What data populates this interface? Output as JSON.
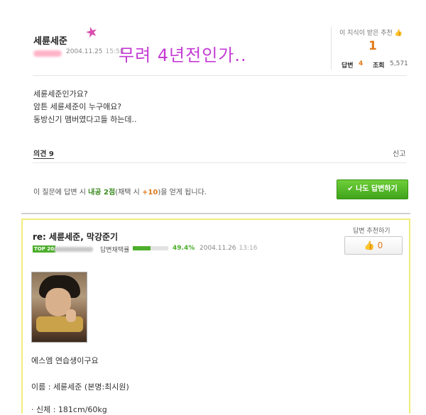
{
  "question": {
    "title": "세륜세준",
    "date": "2004.11.25",
    "time": "15:58",
    "handwritten_note": "무려 4년전인가..",
    "stats": {
      "rec_label": "이 지식이 받은 추천",
      "rec_count": "1",
      "answers_label": "답변",
      "answers_count": "4",
      "views_label": "조회",
      "views_count": "5,571"
    },
    "body": [
      "세륜세준인가요?",
      "암튼 세륜세준이 누구애요?",
      "동방신기 맴버였다고들 하는데.."
    ],
    "opinion_label": "의견 9",
    "report_label": "신고",
    "notice": {
      "pre": "이 질문에 답변 시 ",
      "points": "내공 2점",
      "mid": "(채택 시 ",
      "bonus": "+10",
      "post": ")을 얻게 됩니다."
    },
    "answer_button": "✔ 나도 답변하기"
  },
  "answer": {
    "title": "re: 세륜세준, 막강준기",
    "rec_label": "답변 추천하기",
    "rec_count": "0",
    "badge": "TOP 20",
    "adopt_label": "답변채택률",
    "adopt_pct": "49.4%",
    "adopt_fraction": 0.494,
    "date": "2004.11.26",
    "time": "13:16",
    "lines": [
      "에스엠 연습생이구요",
      "이름 : 세륜세준 (본명:최시원)",
      "· 신체 : 181cm/60kg"
    ]
  },
  "colors": {
    "accent_green": "#4cae2b",
    "accent_orange": "#e07a1a",
    "note_purple": "#c43bd4",
    "answer_border": "#f2ec7a"
  }
}
